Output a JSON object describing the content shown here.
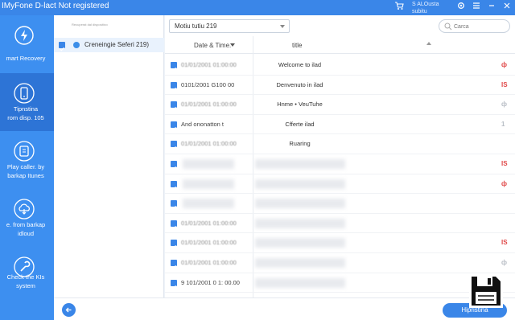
{
  "app": {
    "title": "IMyFone D-lact Not registered"
  },
  "titlebar": {
    "user_line1": "S ALOusta",
    "user_line2": "subitu"
  },
  "sidebar": {
    "items": [
      {
        "label": "mart Recovery",
        "icon": "lightning-recovery-icon"
      },
      {
        "label_line1": "Tipnstina",
        "label_line2": "rom disp. 105",
        "icon": "phone-icon"
      },
      {
        "label_line1": "Play caller. by",
        "label_line2": "barkap Itunes",
        "icon": "itunes-backup-icon"
      },
      {
        "label_line1": "e. from barkap",
        "label_line2": "idloud",
        "icon": "icloud-download-icon"
      },
      {
        "label_line1": "Check the KIs",
        "label_line2": "system",
        "icon": "wrench-icon"
      }
    ]
  },
  "left_panel": {
    "header": "Recuperat dal dispositivo",
    "item_label": "Creneingie Seferi 219)"
  },
  "toolbar": {
    "filter_value": "Motiu tutiu 219",
    "search_placeholder": "Carca"
  },
  "table": {
    "col_date": "Date & Time.",
    "col_title": "title",
    "rows": [
      {
        "date": "01/01/2001 01:00:00",
        "title": "Welcome to ilad",
        "mark": "ф",
        "mark_color": "#e04848",
        "blurred_date": true,
        "blurred_title": false
      },
      {
        "date": "0101/2001 G100 00",
        "title": "Denvenuto in ilad",
        "mark": "IS",
        "mark_color": "#e04848",
        "blurred_date": false,
        "blurred_title": false
      },
      {
        "date": "01/01/2001 01:00:00",
        "title": "Hnme • VeuTuhe",
        "mark": "ф",
        "mark_color": "#b9bec6",
        "blurred_date": true,
        "blurred_title": false
      },
      {
        "date": "And ononatton t",
        "title": "Cfferte ilad",
        "mark": "1",
        "mark_color": "#b9bec6",
        "blurred_date": false,
        "blurred_title": false
      },
      {
        "date": "01/01/2001 01:00:00",
        "title": "Ruaring",
        "mark": "",
        "mark_color": "#b9bec6",
        "blurred_date": true,
        "blurred_title": false
      },
      {
        "date": "",
        "title": "",
        "mark": "IS",
        "mark_color": "#e04848",
        "blurred_date": true,
        "blurred_title": true
      },
      {
        "date": "",
        "title": "",
        "mark": "ф",
        "mark_color": "#e04848",
        "blurred_date": true,
        "blurred_title": true
      },
      {
        "date": "",
        "title": "",
        "mark": "",
        "mark_color": "#b9bec6",
        "blurred_date": true,
        "blurred_title": true
      },
      {
        "date": "01/01/2001 01:00:00",
        "title": "",
        "mark": "",
        "mark_color": "#b9bec6",
        "blurred_date": true,
        "blurred_title": true
      },
      {
        "date": "01/01/2001 01:00:00",
        "title": "",
        "mark": "IS",
        "mark_color": "#e04848",
        "blurred_date": true,
        "blurred_title": true
      },
      {
        "date": "01/01/2001 01:00:00",
        "title": "",
        "mark": "ф",
        "mark_color": "#b9bec6",
        "blurred_date": true,
        "blurred_title": true
      },
      {
        "date": "9 101/2001 0 1: 00.00",
        "title": "",
        "mark": "",
        "mark_color": "#b9bec6",
        "blurred_date": false,
        "blurred_title": true
      }
    ]
  },
  "footer": {
    "restore_label": "Hipristina"
  },
  "colors": {
    "accent": "#3a86e8",
    "sidebar": "#3d8ff0",
    "sidebar_active": "#2d74d6",
    "alert": "#e04848"
  }
}
